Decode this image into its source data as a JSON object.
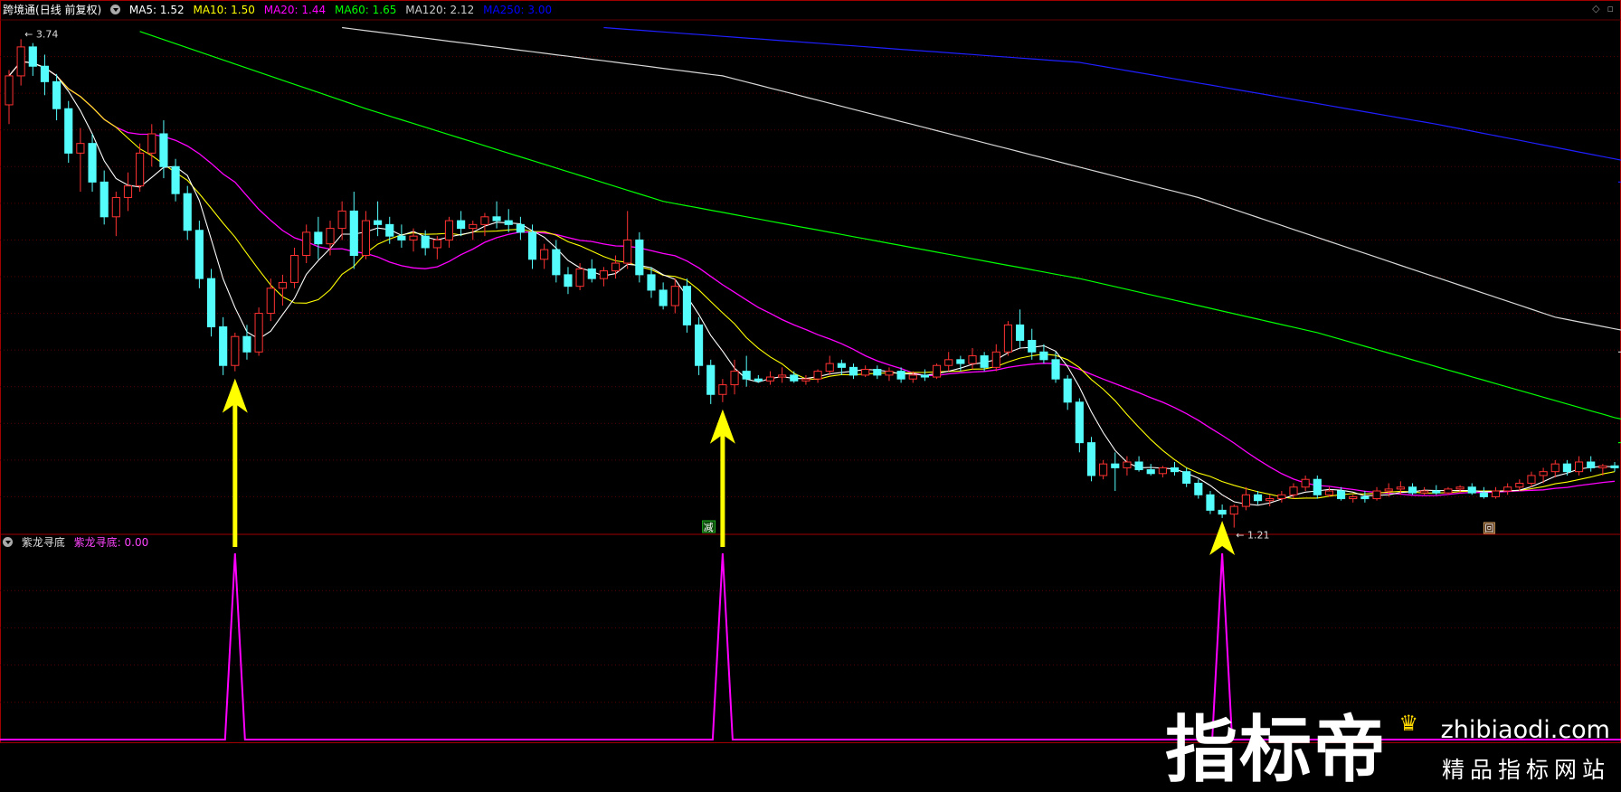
{
  "title": "跨境通",
  "period": "(日线 前复权)",
  "ma_labels": [
    {
      "text": "MA5: 1.52",
      "color": "#ffffff"
    },
    {
      "text": "MA10: 1.50",
      "color": "#ffff00"
    },
    {
      "text": "MA20: 1.44",
      "color": "#ff00ff"
    },
    {
      "text": "MA60: 1.65",
      "color": "#00ff00"
    },
    {
      "text": "MA120: 2.12",
      "color": "#cccccc"
    },
    {
      "text": "MA250: 3.00",
      "color": "#0000ff"
    }
  ],
  "indicator": {
    "name": "紫龙寻底",
    "label": "紫龙寻底: 0.00",
    "color": "#ff44ff"
  },
  "annotations": {
    "high_label": "3.74",
    "low_label": "1.21",
    "marker_text": "减",
    "marker2_text": "回"
  },
  "watermark": {
    "big": "指标帝",
    "url": "zhibiaodi.com",
    "sub": "精品指标网站"
  },
  "colors": {
    "up": "#ff3232",
    "down": "#54fcfc",
    "grid": "#5a0000",
    "frame": "#a00000",
    "arrow": "#ffff00",
    "signal": "#ff00ff"
  },
  "chart_data": {
    "type": "candlestick",
    "high": 3.74,
    "low": 1.21,
    "ylim": [
      1.18,
      3.84
    ],
    "ohlc": [
      [
        3.4,
        3.58,
        3.3,
        3.55
      ],
      [
        3.55,
        3.74,
        3.5,
        3.7
      ],
      [
        3.7,
        3.72,
        3.55,
        3.6
      ],
      [
        3.6,
        3.66,
        3.45,
        3.52
      ],
      [
        3.52,
        3.56,
        3.32,
        3.38
      ],
      [
        3.38,
        3.42,
        3.1,
        3.15
      ],
      [
        3.15,
        3.28,
        2.95,
        3.2
      ],
      [
        3.2,
        3.25,
        2.95,
        3.0
      ],
      [
        3.0,
        3.06,
        2.78,
        2.82
      ],
      [
        2.82,
        2.95,
        2.72,
        2.92
      ],
      [
        2.92,
        3.05,
        2.85,
        2.98
      ],
      [
        2.98,
        3.2,
        2.95,
        3.15
      ],
      [
        3.15,
        3.3,
        3.08,
        3.25
      ],
      [
        3.25,
        3.32,
        3.02,
        3.08
      ],
      [
        3.08,
        3.12,
        2.9,
        2.94
      ],
      [
        2.94,
        2.98,
        2.7,
        2.75
      ],
      [
        2.75,
        2.8,
        2.45,
        2.5
      ],
      [
        2.5,
        2.55,
        2.2,
        2.25
      ],
      [
        2.25,
        2.3,
        2.0,
        2.05
      ],
      [
        2.05,
        2.22,
        2.02,
        2.2
      ],
      [
        2.2,
        2.26,
        2.08,
        2.12
      ],
      [
        2.12,
        2.35,
        2.1,
        2.32
      ],
      [
        2.32,
        2.5,
        2.28,
        2.45
      ],
      [
        2.45,
        2.52,
        2.36,
        2.48
      ],
      [
        2.48,
        2.66,
        2.45,
        2.62
      ],
      [
        2.62,
        2.78,
        2.58,
        2.74
      ],
      [
        2.74,
        2.82,
        2.6,
        2.68
      ],
      [
        2.68,
        2.8,
        2.62,
        2.76
      ],
      [
        2.76,
        2.9,
        2.7,
        2.85
      ],
      [
        2.85,
        2.95,
        2.55,
        2.62
      ],
      [
        2.62,
        2.85,
        2.6,
        2.8
      ],
      [
        2.8,
        2.9,
        2.72,
        2.78
      ],
      [
        2.78,
        2.82,
        2.68,
        2.72
      ],
      [
        2.72,
        2.78,
        2.66,
        2.7
      ],
      [
        2.7,
        2.76,
        2.64,
        2.72
      ],
      [
        2.72,
        2.75,
        2.62,
        2.66
      ],
      [
        2.66,
        2.72,
        2.6,
        2.7
      ],
      [
        2.7,
        2.82,
        2.66,
        2.8
      ],
      [
        2.8,
        2.85,
        2.72,
        2.76
      ],
      [
        2.76,
        2.8,
        2.7,
        2.78
      ],
      [
        2.78,
        2.84,
        2.72,
        2.82
      ],
      [
        2.82,
        2.9,
        2.76,
        2.8
      ],
      [
        2.8,
        2.86,
        2.74,
        2.78
      ],
      [
        2.78,
        2.82,
        2.7,
        2.74
      ],
      [
        2.74,
        2.78,
        2.55,
        2.6
      ],
      [
        2.6,
        2.68,
        2.55,
        2.65
      ],
      [
        2.65,
        2.7,
        2.48,
        2.52
      ],
      [
        2.52,
        2.56,
        2.42,
        2.46
      ],
      [
        2.46,
        2.58,
        2.44,
        2.55
      ],
      [
        2.55,
        2.6,
        2.48,
        2.5
      ],
      [
        2.5,
        2.56,
        2.46,
        2.54
      ],
      [
        2.54,
        2.62,
        2.5,
        2.58
      ],
      [
        2.58,
        2.85,
        2.55,
        2.7
      ],
      [
        2.7,
        2.74,
        2.48,
        2.52
      ],
      [
        2.52,
        2.56,
        2.4,
        2.44
      ],
      [
        2.44,
        2.48,
        2.34,
        2.36
      ],
      [
        2.36,
        2.5,
        2.32,
        2.46
      ],
      [
        2.46,
        2.5,
        2.22,
        2.26
      ],
      [
        2.26,
        2.3,
        2.0,
        2.05
      ],
      [
        2.05,
        2.08,
        1.85,
        1.9
      ],
      [
        1.9,
        1.98,
        1.86,
        1.95
      ],
      [
        1.95,
        2.08,
        1.9,
        2.02
      ],
      [
        2.02,
        2.1,
        1.94,
        1.98
      ],
      [
        1.98,
        2.0,
        1.96,
        1.97
      ],
      [
        1.97,
        2.02,
        1.95,
        1.99
      ],
      [
        1.99,
        2.04,
        1.96,
        2.0
      ],
      [
        2.0,
        2.02,
        1.96,
        1.97
      ],
      [
        1.97,
        2.0,
        1.95,
        1.98
      ],
      [
        1.98,
        2.03,
        1.96,
        2.02
      ],
      [
        2.02,
        2.1,
        2.0,
        2.06
      ],
      [
        2.06,
        2.08,
        2.0,
        2.04
      ],
      [
        2.04,
        2.06,
        1.98,
        2.0
      ],
      [
        2.0,
        2.05,
        1.99,
        2.03
      ],
      [
        2.03,
        2.05,
        1.98,
        2.0
      ],
      [
        2.0,
        2.04,
        1.97,
        2.02
      ],
      [
        2.02,
        2.04,
        1.96,
        1.98
      ],
      [
        1.98,
        2.02,
        1.96,
        2.0
      ],
      [
        2.0,
        2.03,
        1.97,
        1.99
      ],
      [
        1.99,
        2.06,
        1.98,
        2.05
      ],
      [
        2.05,
        2.12,
        2.02,
        2.08
      ],
      [
        2.08,
        2.1,
        2.02,
        2.06
      ],
      [
        2.06,
        2.14,
        2.03,
        2.1
      ],
      [
        2.1,
        2.12,
        2.02,
        2.04
      ],
      [
        2.04,
        2.16,
        2.02,
        2.12
      ],
      [
        2.12,
        2.28,
        2.1,
        2.26
      ],
      [
        2.26,
        2.34,
        2.14,
        2.18
      ],
      [
        2.18,
        2.24,
        2.08,
        2.12
      ],
      [
        2.12,
        2.16,
        2.06,
        2.08
      ],
      [
        2.08,
        2.12,
        1.96,
        1.98
      ],
      [
        1.98,
        2.0,
        1.82,
        1.86
      ],
      [
        1.86,
        1.88,
        1.6,
        1.65
      ],
      [
        1.65,
        1.68,
        1.45,
        1.48
      ],
      [
        1.48,
        1.56,
        1.46,
        1.54
      ],
      [
        1.54,
        1.6,
        1.4,
        1.52
      ],
      [
        1.52,
        1.58,
        1.48,
        1.55
      ],
      [
        1.55,
        1.58,
        1.5,
        1.51
      ],
      [
        1.51,
        1.54,
        1.48,
        1.49
      ],
      [
        1.49,
        1.53,
        1.47,
        1.52
      ],
      [
        1.52,
        1.55,
        1.48,
        1.5
      ],
      [
        1.5,
        1.52,
        1.42,
        1.44
      ],
      [
        1.44,
        1.46,
        1.36,
        1.38
      ],
      [
        1.38,
        1.4,
        1.28,
        1.3
      ],
      [
        1.3,
        1.33,
        1.26,
        1.28
      ],
      [
        1.28,
        1.33,
        1.21,
        1.32
      ],
      [
        1.32,
        1.42,
        1.3,
        1.38
      ],
      [
        1.38,
        1.4,
        1.33,
        1.35
      ],
      [
        1.35,
        1.38,
        1.32,
        1.36
      ],
      [
        1.36,
        1.4,
        1.34,
        1.38
      ],
      [
        1.38,
        1.44,
        1.36,
        1.42
      ],
      [
        1.42,
        1.48,
        1.4,
        1.46
      ],
      [
        1.46,
        1.48,
        1.36,
        1.38
      ],
      [
        1.38,
        1.42,
        1.37,
        1.4
      ],
      [
        1.4,
        1.42,
        1.35,
        1.36
      ],
      [
        1.36,
        1.38,
        1.34,
        1.37
      ],
      [
        1.37,
        1.4,
        1.34,
        1.36
      ],
      [
        1.36,
        1.42,
        1.35,
        1.4
      ],
      [
        1.4,
        1.44,
        1.37,
        1.41
      ],
      [
        1.41,
        1.45,
        1.38,
        1.42
      ],
      [
        1.42,
        1.44,
        1.38,
        1.39
      ],
      [
        1.39,
        1.42,
        1.38,
        1.4
      ],
      [
        1.4,
        1.43,
        1.38,
        1.39
      ],
      [
        1.39,
        1.42,
        1.38,
        1.41
      ],
      [
        1.41,
        1.43,
        1.39,
        1.42
      ],
      [
        1.42,
        1.44,
        1.38,
        1.39
      ],
      [
        1.39,
        1.42,
        1.36,
        1.37
      ],
      [
        1.37,
        1.42,
        1.36,
        1.4
      ],
      [
        1.4,
        1.44,
        1.38,
        1.42
      ],
      [
        1.42,
        1.46,
        1.4,
        1.44
      ],
      [
        1.44,
        1.5,
        1.42,
        1.48
      ],
      [
        1.48,
        1.52,
        1.44,
        1.5
      ],
      [
        1.5,
        1.56,
        1.47,
        1.54
      ],
      [
        1.54,
        1.56,
        1.48,
        1.5
      ],
      [
        1.5,
        1.58,
        1.48,
        1.55
      ],
      [
        1.55,
        1.58,
        1.5,
        1.52
      ],
      [
        1.52,
        1.54,
        1.48,
        1.53
      ],
      [
        1.53,
        1.55,
        1.5,
        1.52
      ]
    ],
    "ma60_anchors": [
      [
        11,
        3.78
      ],
      [
        30,
        3.38
      ],
      [
        55,
        2.9
      ],
      [
        90,
        2.5
      ],
      [
        110,
        2.22
      ],
      [
        135,
        1.78
      ],
      [
        145,
        1.65
      ]
    ],
    "ma120_anchors": [
      [
        28,
        3.8
      ],
      [
        60,
        3.55
      ],
      [
        100,
        2.92
      ],
      [
        130,
        2.3
      ],
      [
        145,
        2.12
      ]
    ],
    "ma250_anchors": [
      [
        50,
        3.8
      ],
      [
        90,
        3.62
      ],
      [
        120,
        3.3
      ],
      [
        145,
        3.0
      ]
    ],
    "signal_index": [
      19,
      60,
      102
    ],
    "signal_value": 0.0
  }
}
